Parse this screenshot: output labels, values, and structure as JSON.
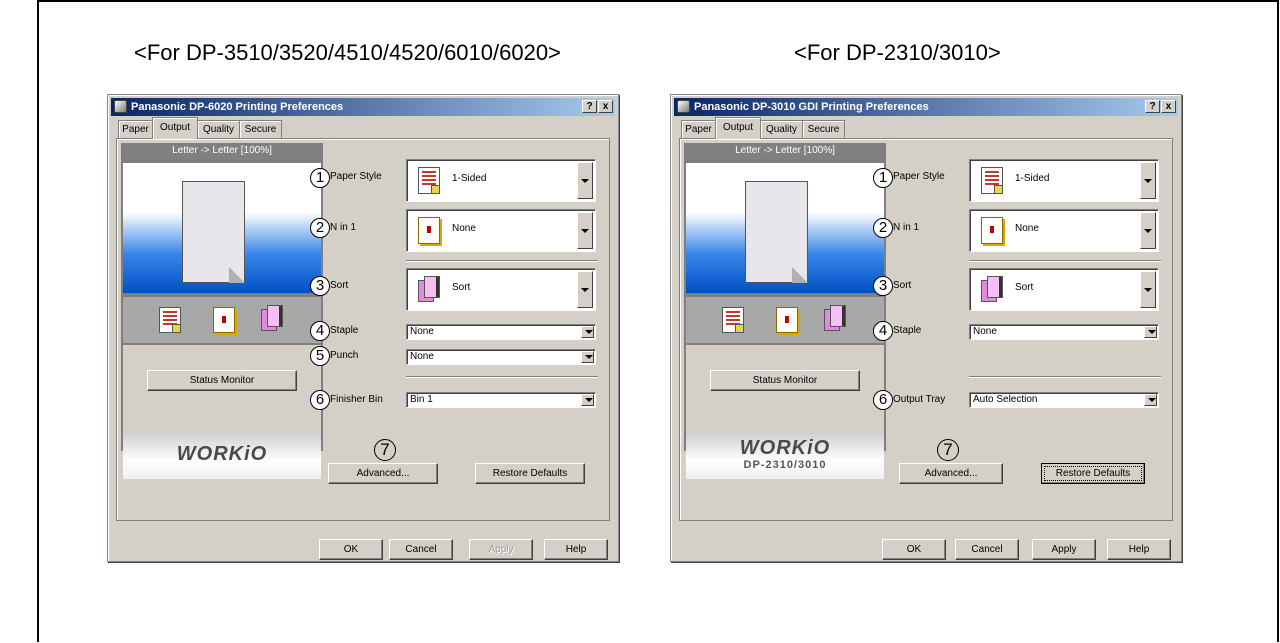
{
  "headings": {
    "left": "<For DP-3510/3520/4510/4520/6010/6020>",
    "right": "<For DP-2310/3010>"
  },
  "dialog_left": {
    "title": "Panasonic DP-6020 Printing Preferences",
    "help_btn": "?",
    "close_btn": "x",
    "tabs": [
      "Paper",
      "Output",
      "Quality",
      "Secure"
    ],
    "active_tab": "Output",
    "preview_header": "Letter -> Letter [100%]",
    "status_monitor": "Status Monitor",
    "logo": "WORKiO",
    "paper_style": {
      "num": "1",
      "label": "Paper Style",
      "value": "1-Sided"
    },
    "n_in_1": {
      "num": "2",
      "label": "N in 1",
      "value": "None"
    },
    "sort": {
      "num": "3",
      "label": "Sort",
      "value": "Sort"
    },
    "staple": {
      "num": "4",
      "label": "Staple",
      "value": "None"
    },
    "punch": {
      "num": "5",
      "label": "Punch",
      "value": "None"
    },
    "finisher_bin": {
      "num": "6",
      "label": "Finisher Bin",
      "value": "Bin 1"
    },
    "advanced": {
      "num": "7",
      "label": "Advanced..."
    },
    "restore_defaults": "Restore Defaults",
    "buttons": {
      "ok": "OK",
      "cancel": "Cancel",
      "apply": "Apply",
      "help": "Help"
    }
  },
  "dialog_right": {
    "title": "Panasonic DP-3010 GDI Printing Preferences",
    "help_btn": "?",
    "close_btn": "x",
    "tabs": [
      "Paper",
      "Output",
      "Quality",
      "Secure"
    ],
    "active_tab": "Output",
    "preview_header": "Letter -> Letter [100%]",
    "status_monitor": "Status Monitor",
    "logo": "WORKiO",
    "logo_sub": "DP-2310/3010",
    "paper_style": {
      "num": "1",
      "label": "Paper Style",
      "value": "1-Sided"
    },
    "n_in_1": {
      "num": "2",
      "label": "N in 1",
      "value": "None"
    },
    "sort": {
      "num": "3",
      "label": "Sort",
      "value": "Sort"
    },
    "staple": {
      "num": "4",
      "label": "Staple",
      "value": "None"
    },
    "output_tray": {
      "num": "6",
      "label": "Output Tray",
      "value": "Auto Selection"
    },
    "advanced": {
      "num": "7",
      "label": "Advanced..."
    },
    "restore_defaults": "Restore Defaults",
    "buttons": {
      "ok": "OK",
      "cancel": "Cancel",
      "apply": "Apply",
      "help": "Help"
    }
  },
  "colors": {
    "titlebar_start": "#0a246a",
    "titlebar_end": "#a6caf0",
    "dialog_face": "#d4d0c8"
  }
}
